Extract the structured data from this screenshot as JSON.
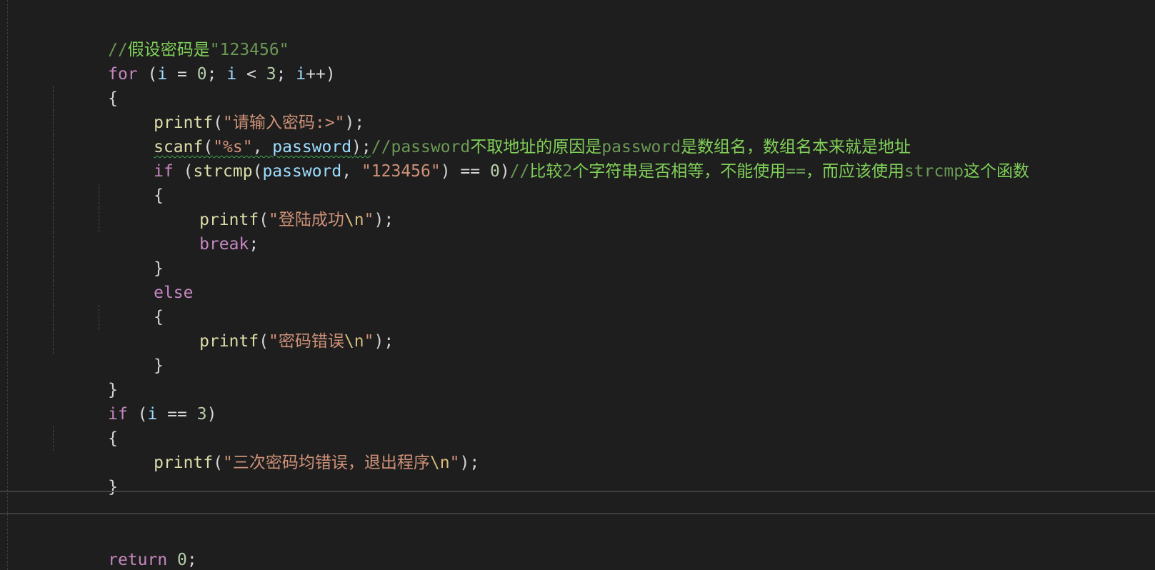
{
  "editor": {
    "lines": {
      "l1": {
        "comment_prefix": "//",
        "comment_zh": "假设密码是",
        "comment_str": "\"123456\""
      },
      "l2": {
        "kw": "for",
        "p1": " (",
        "v1": "i",
        "p2": " = ",
        "n1": "0",
        "p3": "; ",
        "v2": "i",
        "p4": " < ",
        "n2": "3",
        "p5": "; ",
        "v3": "i",
        "p6": "++)"
      },
      "l3": {
        "brace": "{"
      },
      "l4": {
        "fn": "printf",
        "p1": "(",
        "str_open": "\"",
        "str_zh": "请输入密码",
        "str_close": ":>\"",
        "p2": ");"
      },
      "l5": {
        "fn": "scanf",
        "p1": "(",
        "str": "\"%s\"",
        "p2": ", ",
        "var": "password",
        "p3": ");",
        "c_prefix": "//password",
        "c_zh1": "不取地址的原因是",
        "c_mid": "password",
        "c_zh2": "是数组名，数组名本来就是地址"
      },
      "l6": {
        "kw": "if",
        "p1": " (",
        "fn": "strcmp",
        "p2": "(",
        "var": "password",
        "p3": ", ",
        "str": "\"123456\"",
        "p4": ") == ",
        "num": "0",
        "p5": ")",
        "c_prefix": "//",
        "c_zh1": "比较",
        "c_num": "2",
        "c_zh2": "个字符串是否相等，不能使用",
        "c_op": "==",
        "c_zh3": "，而应该使用",
        "c_fn": "strcmp",
        "c_zh4": "这个函数"
      },
      "l7": {
        "brace": "{"
      },
      "l8": {
        "fn": "printf",
        "p1": "(",
        "str_open": "\"",
        "str_zh": "登陆成功",
        "esc": "\\n",
        "str_close": "\"",
        "p2": ");"
      },
      "l9": {
        "kw": "break",
        "p1": ";"
      },
      "l10": {
        "brace": "}"
      },
      "l11": {
        "kw": "else"
      },
      "l12": {
        "brace": "{"
      },
      "l13": {
        "fn": "printf",
        "p1": "(",
        "str_open": "\"",
        "str_zh": "密码错误",
        "esc": "\\n",
        "str_close": "\"",
        "p2": ");"
      },
      "l14": {
        "brace": "}"
      },
      "l15": {
        "brace": "}"
      },
      "l16": {
        "kw": "if",
        "p1": " (",
        "v1": "i",
        "p2": " == ",
        "n1": "3",
        "p3": ")"
      },
      "l17": {
        "brace": "{"
      },
      "l18": {
        "fn": "printf",
        "p1": "(",
        "str_open": "\"",
        "str_zh": "三次密码均错误，退出程序",
        "esc": "\\n",
        "str_close": "\"",
        "p2": ");"
      },
      "l19": {
        "brace": "}"
      },
      "l22": {
        "kw": "return",
        "p1": " ",
        "num": "0",
        "p2": ";"
      }
    }
  }
}
